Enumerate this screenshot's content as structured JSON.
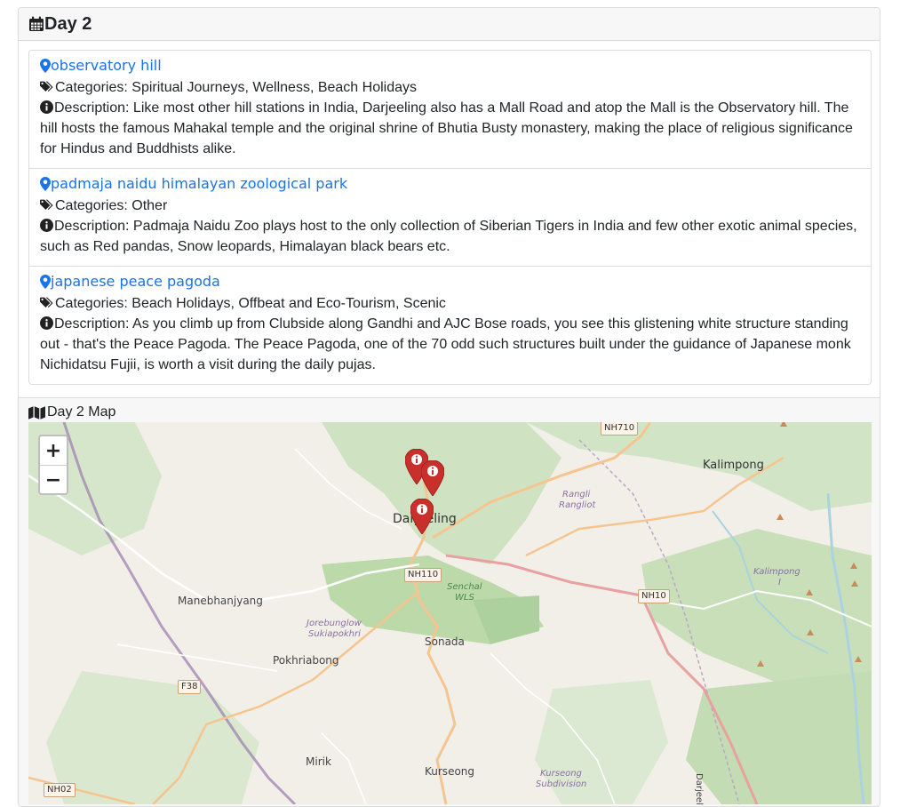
{
  "day": {
    "title": "Day 2"
  },
  "places": [
    {
      "name": "observatory hill",
      "categories": "Categories: Spiritual Journeys, Wellness, Beach Holidays",
      "description": "Description: Like most other hill stations in India, Darjeeling also has a Mall Road and atop the Mall is the Observatory hill. The hill hosts the famous Mahakal temple and the original shrine of Bhutia Busty monastery, making the place of religious significance for Hindus and Buddhists alike."
    },
    {
      "name": "padmaja naidu himalayan zoological park",
      "categories": "Categories: Other",
      "description": "Description: Padmaja Naidu Zoo plays host to the only collection of Siberian Tigers in India and few other exotic animal species, such as Red pandas, Snow leopards, Himalayan black bears etc."
    },
    {
      "name": "japanese peace pagoda",
      "categories": "Categories: Beach Holidays, Offbeat and Eco-Tourism, Scenic",
      "description": "Description: As you climb up from Clubside along Gandhi and AJC Bose roads, you see this glistening white structure standing out - that's the Peace Pagoda. The Peace Pagoda, one of the 70 odd such structures built under the guidance of Japanese monk Nichidatsu Fujii, is worth a visit during the daily pujas."
    }
  ],
  "map": {
    "label": "Day 2 Map",
    "zoom_in": "+",
    "zoom_out": "−",
    "labels": {
      "kalimpong": "Kalimpong",
      "darjeeling": "Darjeeling",
      "manebhanjyang": "Manebhanjyang",
      "sonada": "Sonada",
      "pokhriabong": "Pokhriabong",
      "mirik": "Mirik",
      "kurseong": "Kurseong",
      "rangli_1": "Rangli",
      "rangli_2": "Rangliot",
      "kalimpong_1": "Kalimpong",
      "kalimpong_2": "I",
      "senchal_1": "Senchal",
      "senchal_2": "WLS",
      "jore_1": "Jorebunglow",
      "jore_2": "Sukiapokhri",
      "kurseong_sub_1": "Kurseong",
      "kurseong_sub_2": "Subdivision",
      "darjeeling_side": "Darjeeling"
    },
    "roads": {
      "nh710": "NH710",
      "nh110": "NH110",
      "nh10": "NH10",
      "f38": "F38",
      "nh02": "NH02"
    },
    "colors": {
      "marker": "#c9302c",
      "link": "#1a73e8",
      "forest": "#add19e",
      "water": "#aad3df"
    }
  }
}
